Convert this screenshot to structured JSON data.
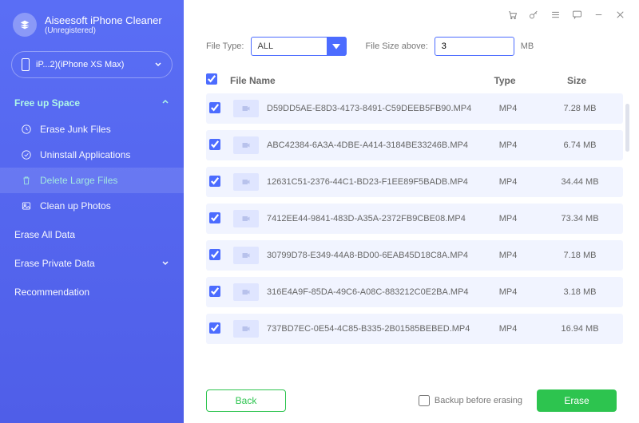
{
  "brand": {
    "name": "Aiseesoft iPhone Cleaner",
    "sub": "(Unregistered)"
  },
  "device": {
    "label": "iP...2)(iPhone XS Max)"
  },
  "sidebar": {
    "free_up": "Free up Space",
    "items": [
      {
        "label": "Erase Junk Files"
      },
      {
        "label": "Uninstall Applications"
      },
      {
        "label": "Delete Large Files"
      },
      {
        "label": "Clean up Photos"
      }
    ],
    "erase_all": "Erase All Data",
    "erase_private": "Erase Private Data",
    "recommendation": "Recommendation"
  },
  "filter": {
    "file_type_label": "File Type:",
    "file_type_value": "ALL",
    "file_size_label": "File Size above:",
    "file_size_value": "3",
    "mb": "MB"
  },
  "headers": {
    "name": "File Name",
    "type": "Type",
    "size": "Size"
  },
  "files": [
    {
      "name": "D59DD5AE-E8D3-4173-8491-C59DEEB5FB90.MP4",
      "type": "MP4",
      "size": "7.28 MB"
    },
    {
      "name": "ABC42384-6A3A-4DBE-A414-3184BE33246B.MP4",
      "type": "MP4",
      "size": "6.74 MB"
    },
    {
      "name": "12631C51-2376-44C1-BD23-F1EE89F5BADB.MP4",
      "type": "MP4",
      "size": "34.44 MB"
    },
    {
      "name": "7412EE44-9841-483D-A35A-2372FB9CBE08.MP4",
      "type": "MP4",
      "size": "73.34 MB"
    },
    {
      "name": "30799D78-E349-44A8-BD00-6EAB45D18C8A.MP4",
      "type": "MP4",
      "size": "7.18 MB"
    },
    {
      "name": "316E4A9F-85DA-49C6-A08C-883212C0E2BA.MP4",
      "type": "MP4",
      "size": "3.18 MB"
    },
    {
      "name": "737BD7EC-0E54-4C85-B335-2B01585BEBED.MP4",
      "type": "MP4",
      "size": "16.94 MB"
    }
  ],
  "footer": {
    "back": "Back",
    "backup": "Backup before erasing",
    "erase": "Erase"
  }
}
